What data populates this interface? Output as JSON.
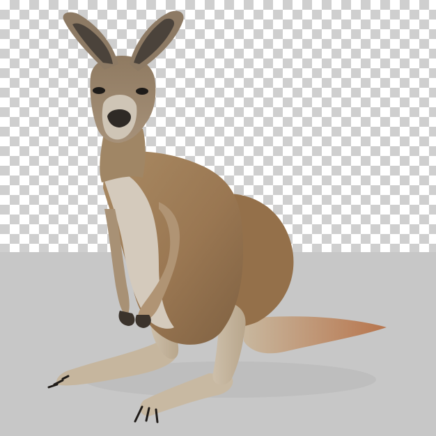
{
  "image": {
    "subject": "kangaroo",
    "background": {
      "top": "transparency-checkerboard",
      "bottom": "light-gray-floor"
    },
    "colors": {
      "floor": "#c7c7c7",
      "checker_light": "#ffffff",
      "checker_dark": "#cfcfcf",
      "fur_main": "#9b7a55",
      "fur_light": "#cfc5b6",
      "fur_dark": "#6f5538",
      "ear_inner": "#3f3a34",
      "claws": "#1f1b18"
    }
  }
}
